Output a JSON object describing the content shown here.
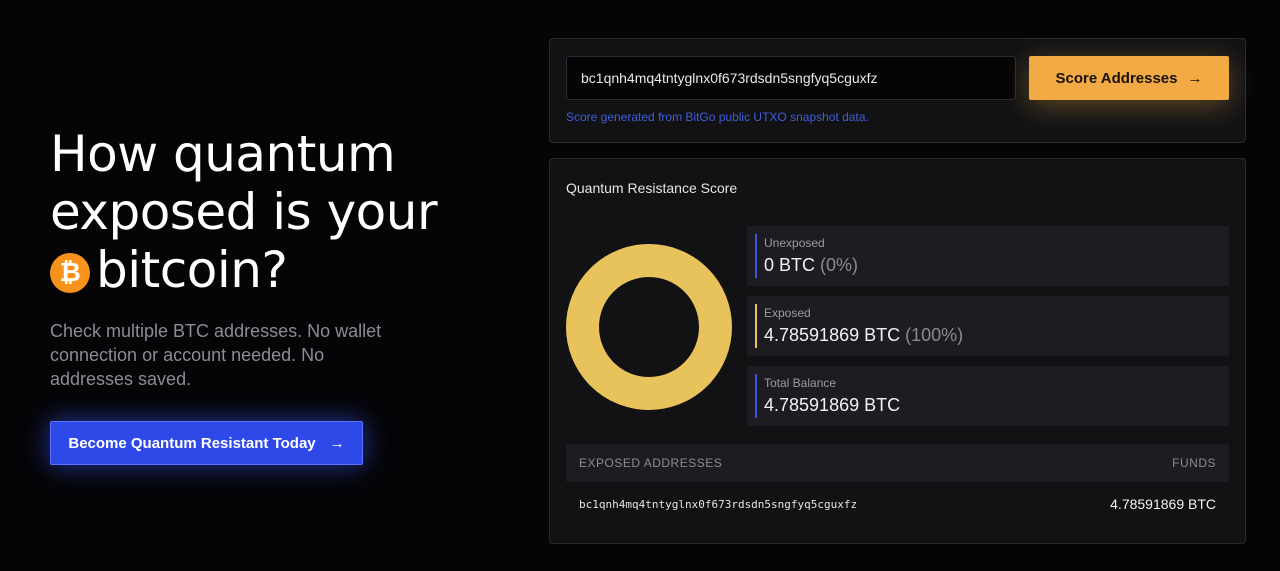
{
  "hero": {
    "title_line1": "How quantum",
    "title_line2": "exposed is your",
    "title_line3": "bitcoin?",
    "coin_symbol": "₿",
    "subtitle": "Check multiple BTC addresses. No wallet connection or account needed. No addresses saved.",
    "cta_label": "Become Quantum Resistant Today",
    "cta_arrow": "→"
  },
  "search": {
    "value": "bc1qnh4mq4tntyglnx0f673rdsdn5sngfyq5cguxfz",
    "button_label": "Score Addresses",
    "button_arrow": "→",
    "source_note": "Score generated from BitGo public UTXO snapshot data."
  },
  "score": {
    "title": "Quantum Resistance Score",
    "exposed_fraction": 1.0,
    "unexposed": {
      "label": "Unexposed",
      "value": "0 BTC",
      "pct": "(0%)"
    },
    "exposed": {
      "label": "Exposed",
      "value": "4.78591869 BTC",
      "pct": "(100%)"
    },
    "total": {
      "label": "Total Balance",
      "value": "4.78591869 BTC"
    }
  },
  "table": {
    "col_address": "EXPOSED ADDRESSES",
    "col_funds": "FUNDS",
    "rows": [
      {
        "address": "bc1qnh4mq4tntyglnx0f673rdsdn5sngfyq5cguxfz",
        "funds": "4.78591869 BTC"
      }
    ]
  },
  "colors": {
    "unexposed": "#3b57e0",
    "exposed": "#e8c35c",
    "total": "#3b57e0",
    "accent_orange": "#f2ab44",
    "accent_blue": "#2f49e8"
  }
}
